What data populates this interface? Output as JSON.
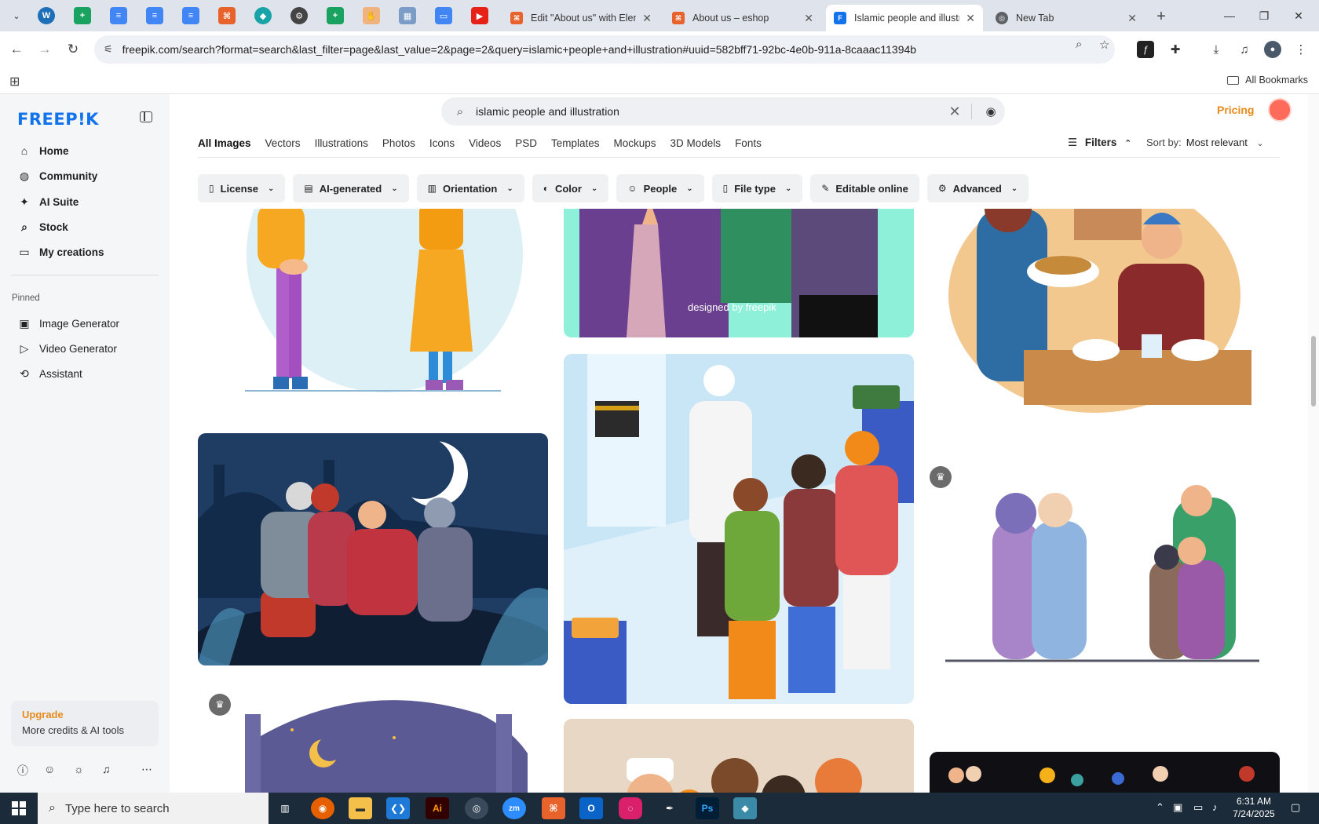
{
  "browser": {
    "tabs": [
      {
        "title": "Edit \"About us\" with Elem",
        "icon": "elementor-icon",
        "active": false
      },
      {
        "title": "About us – eshop",
        "icon": "elementor-icon",
        "active": false
      },
      {
        "title": "Islamic people and illustr",
        "icon": "freepik-icon",
        "active": true
      },
      {
        "title": "New Tab",
        "icon": "chrome-icon",
        "active": false
      }
    ],
    "url": "freepik.com/search?format=search&last_filter=page&last_value=2&page=2&query=islamic+people+and+illustration#uuid=582bff71-92bc-4e0b-911a-8caaac11394b",
    "bookmarks_label": "All Bookmarks"
  },
  "sidebar": {
    "logo": "FREEP!K",
    "nav": [
      {
        "label": "Home",
        "icon": "home-icon"
      },
      {
        "label": "Community",
        "icon": "globe-icon"
      },
      {
        "label": "AI Suite",
        "icon": "sparkle-icon"
      },
      {
        "label": "Stock",
        "icon": "search-icon"
      },
      {
        "label": "My creations",
        "icon": "folder-icon"
      }
    ],
    "pinned_label": "Pinned",
    "pinned": [
      {
        "label": "Image Generator",
        "icon": "image-icon"
      },
      {
        "label": "Video Generator",
        "icon": "video-icon"
      },
      {
        "label": "Assistant",
        "icon": "assistant-icon"
      }
    ],
    "upgrade_title": "Upgrade",
    "upgrade_sub": "More credits & AI tools"
  },
  "header": {
    "search_value": "islamic people and illustration",
    "pricing": "Pricing"
  },
  "content_tabs": [
    "All Images",
    "Vectors",
    "Illustrations",
    "Photos",
    "Icons",
    "Videos",
    "PSD",
    "Templates",
    "Mockups",
    "3D Models",
    "Fonts"
  ],
  "filters_label": "Filters",
  "sort": {
    "label": "Sort by:",
    "value": "Most relevant"
  },
  "chips": [
    {
      "label": "License",
      "icon": "license-icon"
    },
    {
      "label": "AI-generated",
      "icon": "ai-icon"
    },
    {
      "label": "Orientation",
      "icon": "orientation-icon"
    },
    {
      "label": "Color",
      "icon": "palette-icon"
    },
    {
      "label": "People",
      "icon": "people-icon"
    },
    {
      "label": "File type",
      "icon": "file-icon"
    },
    {
      "label": "Editable online",
      "icon": "pencil-icon"
    },
    {
      "label": "Advanced",
      "icon": "gear-icon"
    }
  ],
  "watermark": "designed by freepik",
  "taskbar": {
    "search_placeholder": "Type here to search",
    "time": "6:31 AM",
    "date": "7/24/2025"
  },
  "colors": {
    "freepik_blue": "#1273eb",
    "pricing_orange": "#e88a1a",
    "taskbar_bg": "#1c2b3a"
  }
}
